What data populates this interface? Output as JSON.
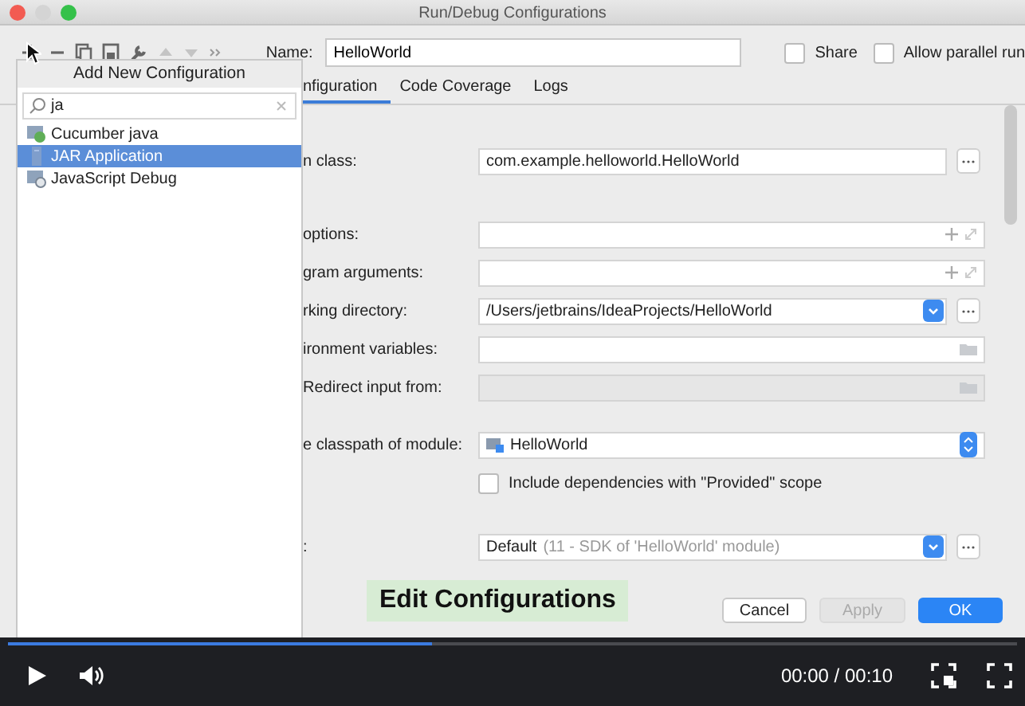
{
  "window": {
    "title": "Run/Debug Configurations"
  },
  "name_field": {
    "label": "Name:",
    "value": "HelloWorld"
  },
  "options": [
    {
      "label": "Share",
      "checked": false
    },
    {
      "label": "Allow parallel run",
      "checked": false
    }
  ],
  "tabs": [
    {
      "label": "nfiguration",
      "selected": true
    },
    {
      "label": "Code Coverage",
      "selected": false
    },
    {
      "label": "Logs",
      "selected": false
    }
  ],
  "form": [
    {
      "kind": "text-more",
      "label": "n class:",
      "value": "com.example.helloworld.HelloWorld"
    },
    {
      "kind": "text-expand",
      "label": "options:"
    },
    {
      "kind": "text-expand",
      "label": "gram arguments:"
    },
    {
      "kind": "dropdown-more",
      "label": "rking directory:",
      "value": "/Users/jetbrains/IdeaProjects/HelloWorld"
    },
    {
      "kind": "browse",
      "label": "ironment variables:"
    },
    {
      "kind": "disabled-browse",
      "label": "Redirect input from:"
    },
    {
      "kind": "module",
      "label": "e classpath of module:",
      "value": "HelloWorld"
    },
    {
      "kind": "checkbox",
      "label": "Include dependencies with \"Provided\" scope",
      "checked": false
    },
    {
      "kind": "jre",
      "label": ":",
      "value": "Default",
      "hint": "(11 - SDK of 'HelloWorld' module)"
    }
  ],
  "buttons": [
    {
      "label": "Cancel",
      "kind": "normal"
    },
    {
      "label": "Apply",
      "kind": "disabled"
    },
    {
      "label": "OK",
      "kind": "default"
    }
  ],
  "popup": {
    "title": "Add New Configuration",
    "search": "ja",
    "items": [
      {
        "label": "Cucumber java",
        "selected": false,
        "kind": "cucumber"
      },
      {
        "label": "JAR Application",
        "selected": true,
        "kind": "jar"
      },
      {
        "label": "JavaScript Debug",
        "selected": false,
        "kind": "jsdebug"
      }
    ]
  },
  "caption": "Edit Configurations",
  "player": {
    "playing": false,
    "level": 0.42,
    "time": "00:00 / 00:10"
  }
}
